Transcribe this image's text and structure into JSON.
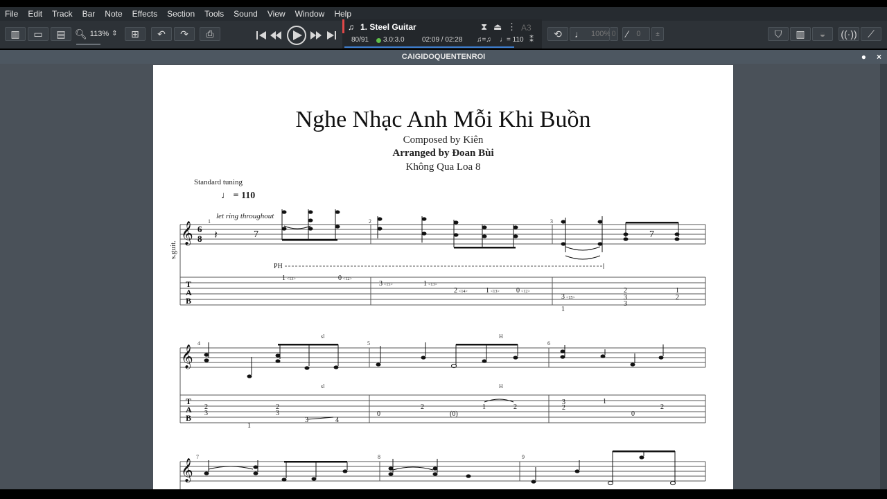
{
  "menu": [
    "File",
    "Edit",
    "Track",
    "Bar",
    "Note",
    "Effects",
    "Section",
    "Tools",
    "Sound",
    "View",
    "Window",
    "Help"
  ],
  "toolbar": {
    "zoom": "113%",
    "track": {
      "name": "1. Steel Guitar",
      "bar": "80/91",
      "time_sig": "3.0:3.0",
      "time": "02:09 / 02:28",
      "tempo": "110",
      "tempo_symbol": "♩= 110"
    },
    "key": "A3",
    "volume": "100%",
    "pan": "0",
    "transpose": "0"
  },
  "document": {
    "tab_title": "CAIGIDOQUENTENROI"
  },
  "score": {
    "title": "Nghe Nhạc Anh Mỗi Khi Buồn",
    "composer": "Composed by Kiên",
    "arranger": "Arranged by Đoan Bùi",
    "subtitle": "Không Qua Loa 8",
    "tuning": "Standard tuning",
    "tempo": "= 110",
    "instrument_label": "s.guit.",
    "let_ring": "let ring throughout",
    "ph": "PH",
    "sl": "sl",
    "h": "H",
    "bar_numbers": [
      "1",
      "2",
      "3",
      "4",
      "5",
      "6",
      "7",
      "8",
      "9"
    ],
    "tab_row1": [
      {
        "f": "1",
        "h": "<13>"
      },
      {
        "f": "0",
        "h": "<12>"
      },
      {
        "f": "3",
        "h": "<15>"
      },
      {
        "f": "1",
        "h": "<13>"
      },
      {
        "f": "2",
        "h": "<14>"
      },
      {
        "f": "1",
        "h": "<13>"
      },
      {
        "f": "0",
        "h": "<12>"
      },
      {
        "f": "3",
        "h": "<15>"
      }
    ]
  },
  "colors": {
    "accent": "#3e7fd0",
    "red_marker": "#e04848"
  }
}
